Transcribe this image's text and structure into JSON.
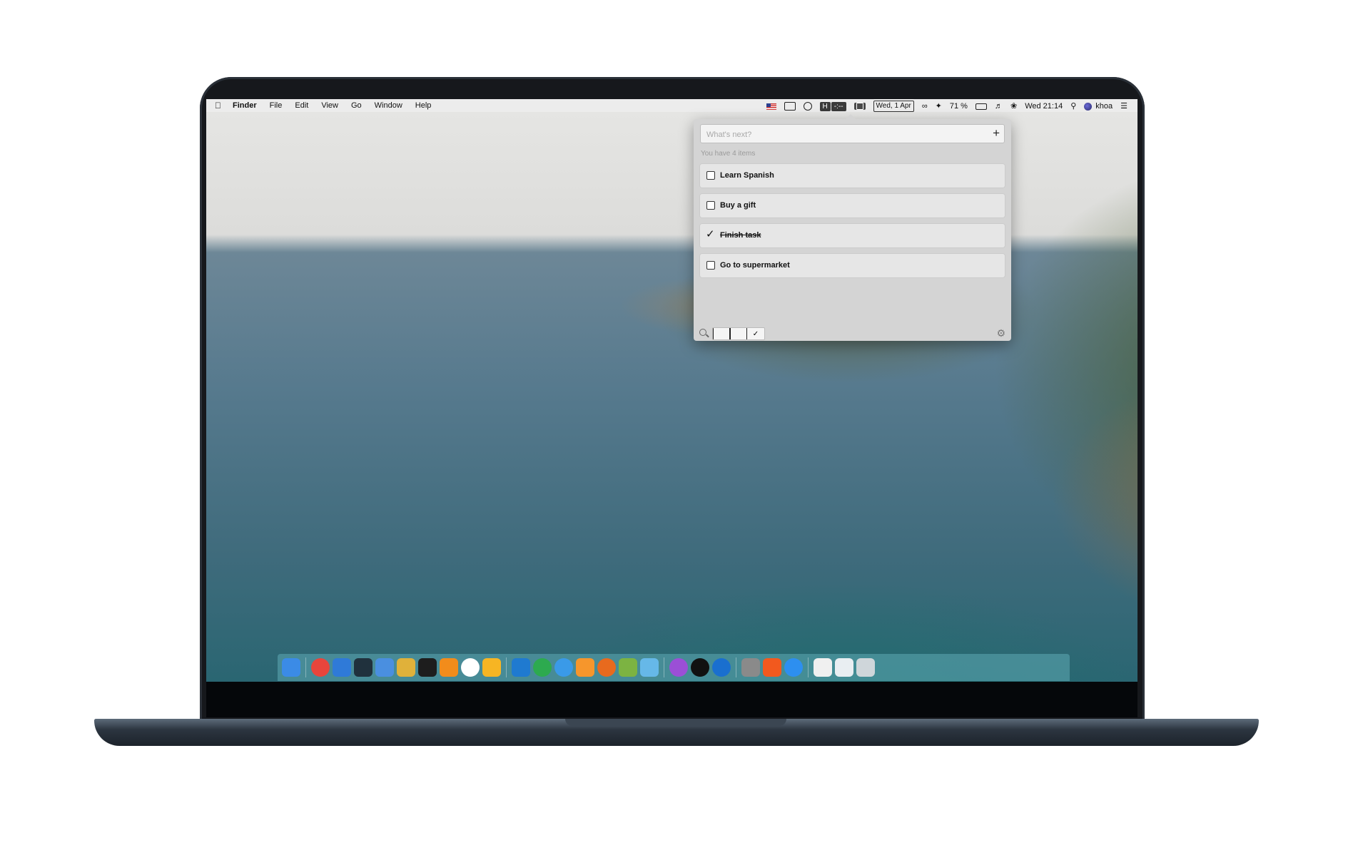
{
  "menubar": {
    "app_name": "Finder",
    "menus": [
      "File",
      "Edit",
      "View",
      "Go",
      "Window",
      "Help"
    ],
    "hidden_label": "H",
    "timer": "-:--",
    "date_box": "Wed, 1 Apr",
    "battery": "71 %",
    "clock": "Wed 21:14",
    "user": "khoa"
  },
  "todo": {
    "placeholder": "What's next?",
    "add_label": "+",
    "count_text": "You have 4 items",
    "items": [
      {
        "label": "Learn Spanish",
        "done": false
      },
      {
        "label": "Buy a gift",
        "done": false
      },
      {
        "label": "Finish task",
        "done": true
      },
      {
        "label": "Go to supermarket",
        "done": false
      }
    ],
    "filter_active": "all"
  },
  "dock": {
    "apps": [
      {
        "name": "finder-icon",
        "color": "#3b8be6"
      },
      {
        "name": "chrome-icon",
        "color": "#e8453c"
      },
      {
        "name": "xcode-icon",
        "color": "#2f7ad8"
      },
      {
        "name": "terminal-prompt-icon",
        "color": "#20313d"
      },
      {
        "name": "files-icon",
        "color": "#4a8fe0"
      },
      {
        "name": "blocks-icon",
        "color": "#e0b13a"
      },
      {
        "name": "terminal-icon",
        "color": "#1d1d1d"
      },
      {
        "name": "sublime-icon",
        "color": "#f28c1b"
      },
      {
        "name": "slack-icon",
        "color": "#ffffff"
      },
      {
        "name": "sketch-icon",
        "color": "#f7b523"
      },
      {
        "name": "vscode-icon",
        "color": "#1f7ad0"
      },
      {
        "name": "evernote-icon",
        "color": "#2daa4f"
      },
      {
        "name": "safari-icon",
        "color": "#3a9ae8"
      },
      {
        "name": "swift-icon",
        "color": "#f6962c"
      },
      {
        "name": "firefox-icon",
        "color": "#e86a1e"
      },
      {
        "name": "android-studio-icon",
        "color": "#7cb342"
      },
      {
        "name": "folder-icon",
        "color": "#66b8e8"
      },
      {
        "name": "podcasts-icon",
        "color": "#9b4fd6"
      },
      {
        "name": "apple-tv-icon",
        "color": "#111111"
      },
      {
        "name": "1password-icon",
        "color": "#1a6fcf"
      },
      {
        "name": "fontbook-icon",
        "color": "#8a8a8a"
      },
      {
        "name": "brave-icon",
        "color": "#f2591e"
      },
      {
        "name": "app-store-icon",
        "color": "#2d8ff0"
      },
      {
        "name": "zipper-icon",
        "color": "#f0f0f0"
      },
      {
        "name": "window-thumb-icon",
        "color": "#e9eef2"
      },
      {
        "name": "trash-icon",
        "color": "#cfd6da"
      }
    ]
  }
}
